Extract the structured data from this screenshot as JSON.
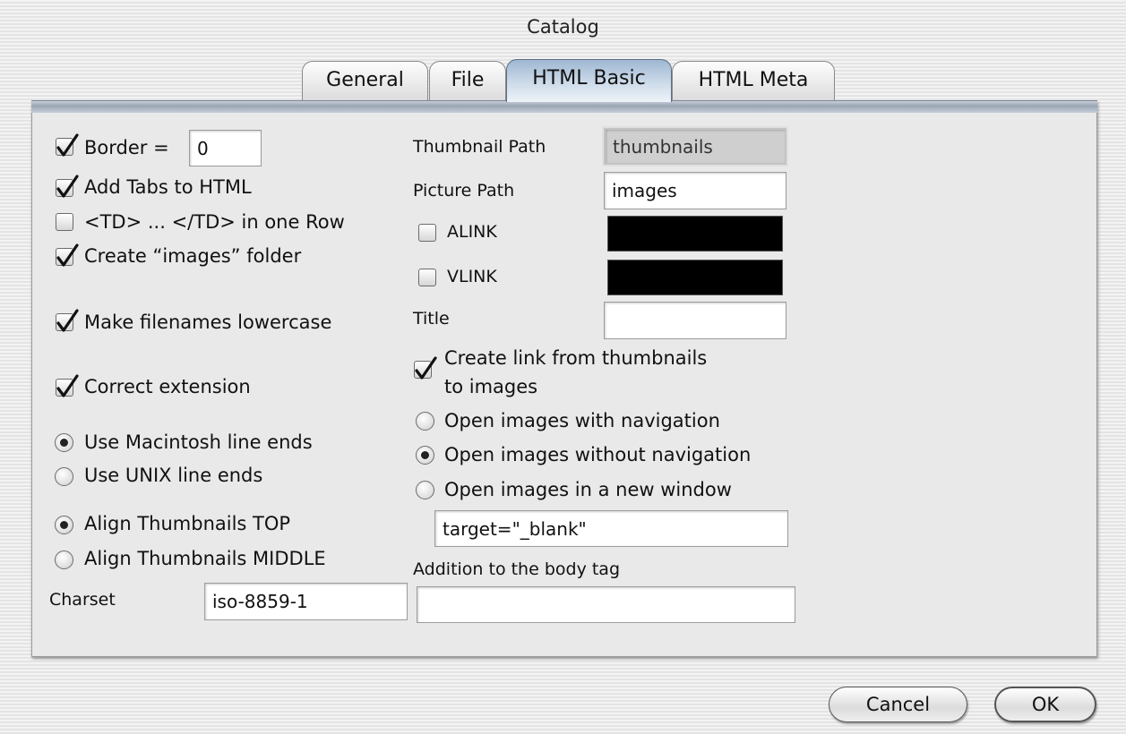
{
  "window": {
    "title": "Catalog"
  },
  "tabs": [
    "General",
    "File",
    "HTML Basic",
    "HTML Meta"
  ],
  "selected_tab": "HTML Basic",
  "left": {
    "border": {
      "label": "Border =",
      "checked": true,
      "value": "0"
    },
    "add_tabs": {
      "label": "Add Tabs to HTML",
      "checked": true
    },
    "td_one_row": {
      "label": "<TD> ... </TD> in one Row",
      "checked": false
    },
    "create_images_folder": {
      "label": "Create “images” folder",
      "checked": true
    },
    "lowercase": {
      "label": "Make filenames lowercase",
      "checked": true
    },
    "correct_ext": {
      "label": "Correct extension",
      "checked": true
    },
    "line_ends": {
      "mac": {
        "label": "Use Macintosh line ends",
        "selected": true
      },
      "unix": {
        "label": "Use UNIX line ends",
        "selected": false
      }
    },
    "align": {
      "top": {
        "label": "Align Thumbnails TOP",
        "selected": true
      },
      "middle": {
        "label": "Align Thumbnails MIDDLE",
        "selected": false
      }
    },
    "charset": {
      "label": "Charset",
      "value": "iso-8859-1"
    }
  },
  "right": {
    "thumbnail_path": {
      "label": "Thumbnail Path",
      "value": "thumbnails"
    },
    "picture_path": {
      "label": "Picture Path",
      "value": "images"
    },
    "alink": {
      "label": "ALINK",
      "checked": false,
      "color": "#000000"
    },
    "vlink": {
      "label": "VLINK",
      "checked": false,
      "color": "#000000"
    },
    "title": {
      "label": "Title",
      "value": ""
    },
    "create_link": {
      "label_line1": "Create link from thumbnails",
      "label_line2": "to images",
      "checked": true
    },
    "open_with_nav": {
      "label": "Open images with navigation",
      "selected": false
    },
    "open_without_nav": {
      "label": "Open images without navigation",
      "selected": true
    },
    "open_new_window": {
      "label": "Open images in a new window",
      "selected": false
    },
    "target": {
      "value": "target=\"_blank\""
    },
    "body_tag": {
      "label": "Addition to the body tag",
      "value": ""
    }
  },
  "buttons": {
    "cancel": "Cancel",
    "ok": "OK"
  },
  "colors": {
    "tab_selected": "#9fb7d3",
    "panel": "#e9e9e9"
  }
}
